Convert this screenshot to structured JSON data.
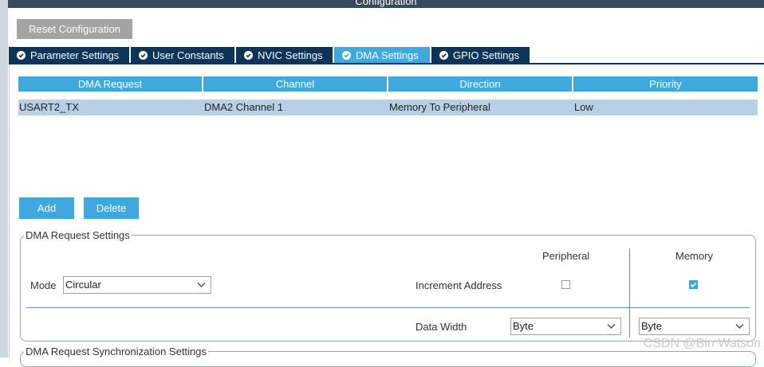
{
  "window": {
    "title": "Configuration"
  },
  "toolbar": {
    "reset_label": "Reset Configuration"
  },
  "tabs": [
    {
      "label": "Parameter Settings",
      "active": false
    },
    {
      "label": "User Constants",
      "active": false
    },
    {
      "label": "NVIC Settings",
      "active": false
    },
    {
      "label": "DMA Settings",
      "active": true
    },
    {
      "label": "GPIO Settings",
      "active": false
    }
  ],
  "dma_table": {
    "headers": [
      "DMA Request",
      "Channel",
      "Direction",
      "Priority"
    ],
    "rows": [
      [
        "USART2_TX",
        "DMA2 Channel 1",
        "Memory To Peripheral",
        "Low"
      ]
    ]
  },
  "actions": {
    "add_label": "Add",
    "delete_label": "Delete"
  },
  "request_settings": {
    "legend": "DMA Request Settings",
    "mode_label": "Mode",
    "mode_value": "Circular",
    "peripheral_header": "Peripheral",
    "memory_header": "Memory",
    "increment_label": "Increment Address",
    "peripheral_increment": false,
    "memory_increment": true,
    "data_width_label": "Data Width",
    "peripheral_width": "Byte",
    "memory_width": "Byte"
  },
  "sync_settings": {
    "legend": "DMA Request Synchronization Settings"
  },
  "watermark": "CSDN @Bin Watson",
  "colors": {
    "accent": "#3fa9dd",
    "tab_dark": "#0d3559",
    "row_selected": "#b8cfe6",
    "button_gray": "#a3a3a3"
  }
}
